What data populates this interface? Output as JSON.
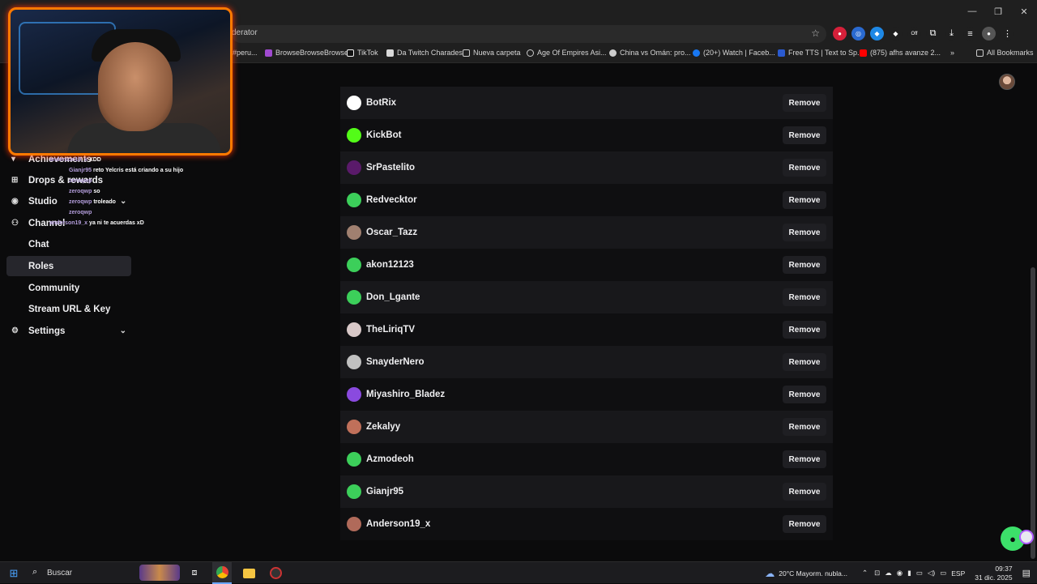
{
  "browser": {
    "url": "derator",
    "window_controls": [
      "—",
      "❐",
      "✕"
    ],
    "bookmarks": [
      {
        "label": "#peru..."
      },
      {
        "label": "BrowseBrowseBrowse"
      },
      {
        "label": "TikTok"
      },
      {
        "label": "Da Twitch Charades"
      },
      {
        "label": "Nueva carpeta"
      },
      {
        "label": "Age Of Empires Asi..."
      },
      {
        "label": "China vs Omán: pro..."
      },
      {
        "label": "(20+) Watch | Faceb..."
      },
      {
        "label": "Free TTS | Text to Sp..."
      },
      {
        "label": "(875) afhs avanze 2..."
      },
      {
        "label": "»"
      },
      {
        "label": "All Bookmarks"
      }
    ],
    "ext_off_label": "Off"
  },
  "sidebar": {
    "items": [
      {
        "label": "Achievements",
        "icon": "trophy-icon",
        "glyph": "▾"
      },
      {
        "label": "Drops & rewards",
        "icon": "drops-icon",
        "glyph": "⊞"
      },
      {
        "label": "Studio",
        "icon": "studio-icon",
        "glyph": "◉",
        "chevron": "⌄"
      },
      {
        "label": "Channel",
        "icon": "channel-icon",
        "glyph": "⚇"
      },
      {
        "label": "Chat"
      },
      {
        "label": "Roles"
      },
      {
        "label": "Community"
      },
      {
        "label": "Stream URL & Key"
      },
      {
        "label": "Settings",
        "icon": "gear-icon",
        "glyph": "⚙",
        "chevron": "⌄"
      }
    ]
  },
  "chat_overlay": [
    {
      "user": "anderson19_x",
      "text": "XDD"
    },
    {
      "user": "Gianjr95",
      "text": "reto Yelcris está criando a su hijo"
    },
    {
      "user": "zeroqwp",
      "text": ""
    },
    {
      "user": "zeroqwp",
      "text": "so"
    },
    {
      "user": "zeroqwp",
      "text": "troleado"
    },
    {
      "user": "zeroqwp",
      "text": ""
    },
    {
      "user": "anderson19_x",
      "text": "ya ni te acuerdas xD"
    }
  ],
  "roles_list": {
    "remove_label": "Remove",
    "users": [
      {
        "name": "BotRix",
        "avatar_color": "#ffffff"
      },
      {
        "name": "KickBot",
        "avatar_color": "#53fc18"
      },
      {
        "name": "SrPastelito",
        "avatar_color": "#5a1a6a"
      },
      {
        "name": "Redvecktor",
        "avatar_color": "#3ccf5a"
      },
      {
        "name": "Oscar_Tazz",
        "avatar_color": "#a08070"
      },
      {
        "name": "akon12123",
        "avatar_color": "#3ccf5a"
      },
      {
        "name": "Don_Lgante",
        "avatar_color": "#3ccf5a"
      },
      {
        "name": "TheLiriqTV",
        "avatar_color": "#d8c8c8"
      },
      {
        "name": "SnayderNero",
        "avatar_color": "#c0c0c0"
      },
      {
        "name": "Miyashiro_Bladez",
        "avatar_color": "#8a4adf"
      },
      {
        "name": "Zekalyy",
        "avatar_color": "#c0705a"
      },
      {
        "name": "Azmodeoh",
        "avatar_color": "#3ccf5a"
      },
      {
        "name": "Gianjr95",
        "avatar_color": "#3ccf5a"
      },
      {
        "name": "Anderson19_x",
        "avatar_color": "#b06a5a"
      }
    ]
  },
  "taskbar": {
    "search_label": "Buscar",
    "weather": "20°C  Mayorm. nubla...",
    "lang": "ESP",
    "time": "09:37",
    "date": "31 dic. 2025"
  }
}
